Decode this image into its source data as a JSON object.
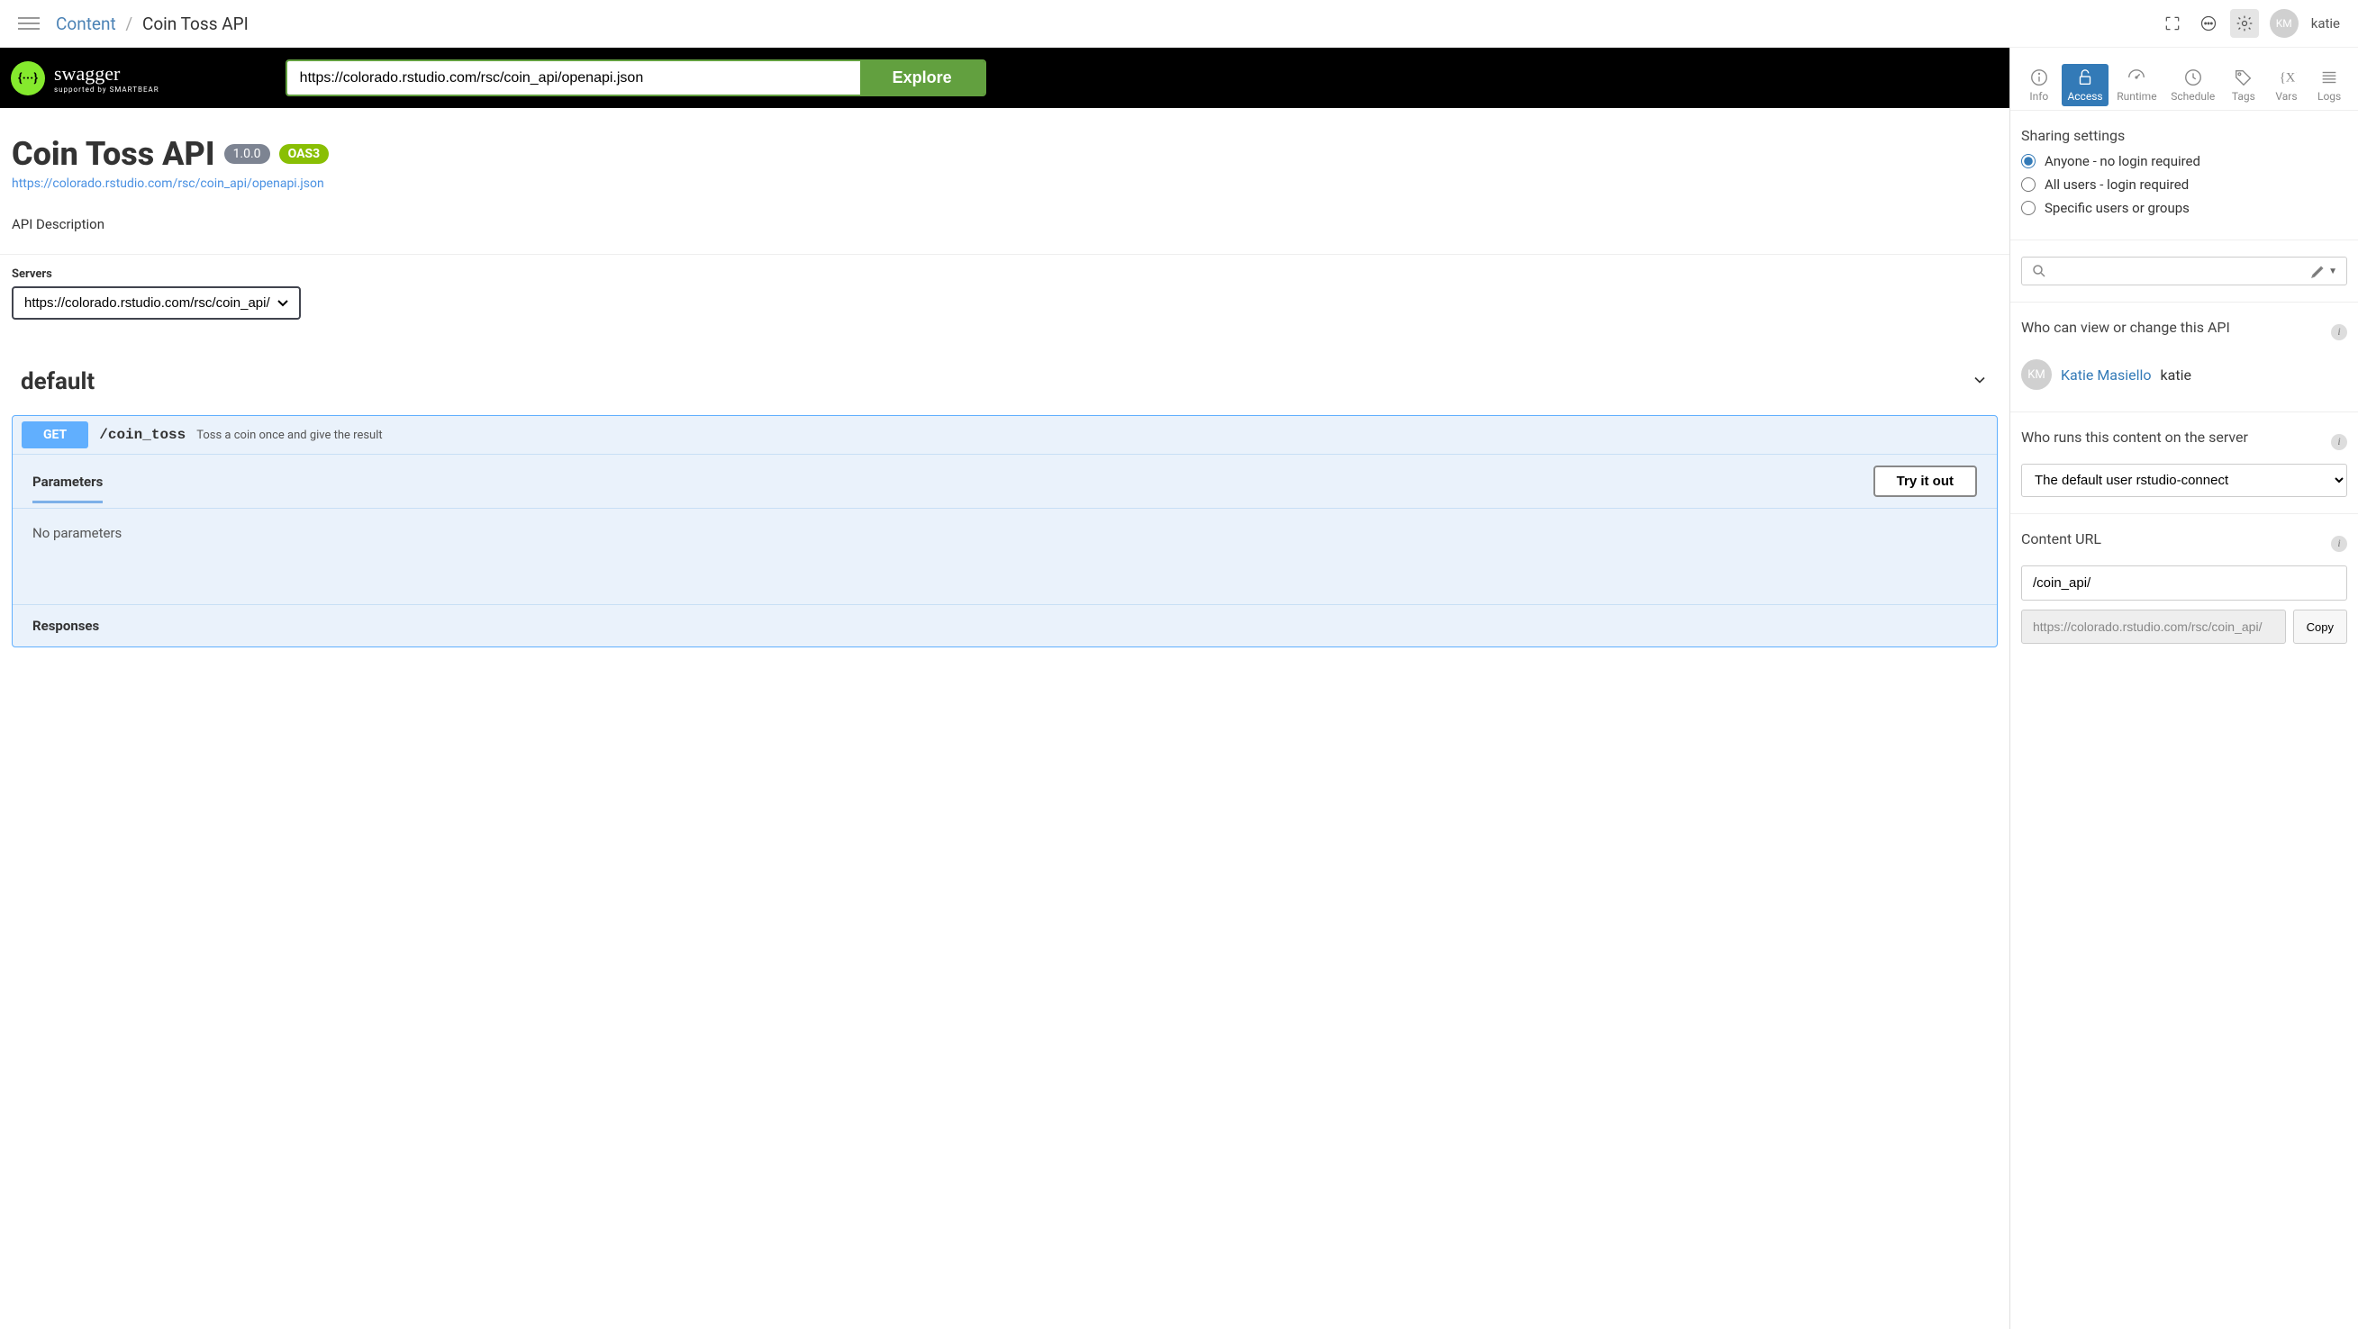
{
  "header": {
    "breadcrumb_root": "Content",
    "breadcrumb_current": "Coin Toss API",
    "username": "katie",
    "avatar_initials": "KM"
  },
  "swagger": {
    "logo_glyph": "{···}",
    "brand": "swagger",
    "byline": "supported by SMARTBEAR",
    "url_input_value": "https://colorado.rstudio.com/rsc/coin_api/openapi.json",
    "explore_label": "Explore"
  },
  "api_info": {
    "title": "Coin Toss API",
    "version": "1.0.0",
    "oas_badge": "OAS3",
    "spec_link": "https://colorado.rstudio.com/rsc/coin_api/openapi.json",
    "description": "API Description"
  },
  "servers": {
    "label": "Servers",
    "selected": "https://colorado.rstudio.com/rsc/coin_api/"
  },
  "ops": {
    "tag_name": "default",
    "method": "GET",
    "path": "/coin_toss",
    "summary": "Toss a coin once and give the result",
    "parameters_label": "Parameters",
    "try_it_label": "Try it out",
    "no_params": "No parameters",
    "responses_label": "Responses"
  },
  "panel": {
    "tabs": {
      "info": "Info",
      "access": "Access",
      "runtime": "Runtime",
      "schedule": "Schedule",
      "tags": "Tags",
      "vars": "Vars",
      "logs": "Logs"
    },
    "sharing": {
      "heading": "Sharing settings",
      "opt_anyone": "Anyone - no login required",
      "opt_all_users": "All users - login required",
      "opt_specific": "Specific users or groups"
    },
    "viewers": {
      "heading": "Who can view or change this API",
      "user_name": "Katie Masiello",
      "user_handle": "katie",
      "user_initials": "KM"
    },
    "runner": {
      "heading": "Who runs this content on the server",
      "selected": "The default user rstudio-connect"
    },
    "content_url": {
      "heading": "Content URL",
      "path_value": "/coin_api/",
      "full_url": "https://colorado.rstudio.com/rsc/coin_api/",
      "copy_label": "Copy"
    }
  }
}
